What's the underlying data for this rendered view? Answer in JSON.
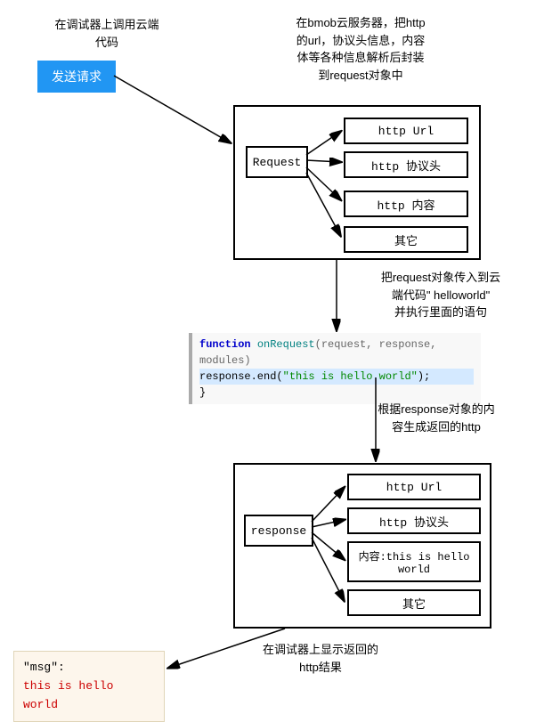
{
  "captions": {
    "top_left": "在调试器上调用云端\n代码",
    "top_right": "在bmob云服务器，把http\n的url，协议头信息，内容\n体等各种信息解析后封装\n到request对象中",
    "mid1": "把request对象传入到云\n端代码\" helloworld\"\n并执行里面的语句",
    "mid2": "根据response对象的内\n容生成返回的http",
    "bottom": "在调试器上显示返回的\nhttp结果"
  },
  "buttons": {
    "send": "发送请求"
  },
  "box1": {
    "label": "Request",
    "items": [
      "http Url",
      "http 协议头",
      "http 内容",
      "其它"
    ]
  },
  "box2": {
    "label": "response",
    "items": [
      "http Url",
      "http 协议头",
      "内容:this is hello\nworld",
      "其它"
    ]
  },
  "code": {
    "kw": "function ",
    "fn": "onRequest",
    "params": "(request, response, modules) ",
    "body_prefix": "    response.end(",
    "body_str": "\"this is hello world\"",
    "body_suffix": ");",
    "close": "}"
  },
  "result": {
    "key": "\"msg\":",
    "val": "this is hello world"
  }
}
